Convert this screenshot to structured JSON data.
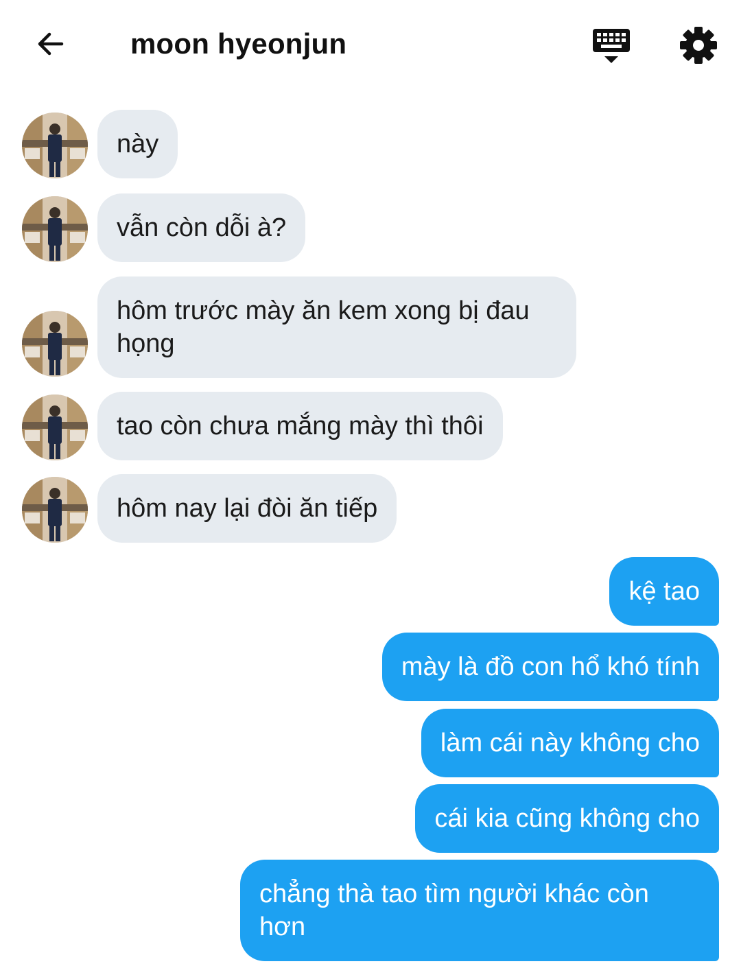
{
  "header": {
    "title": "moon hyeonjun",
    "back_icon": "arrow-left-icon",
    "keyboard_icon": "keyboard-icon",
    "settings_icon": "gear-icon"
  },
  "colors": {
    "incoming_bubble": "#e6ebf0",
    "outgoing_bubble": "#1da1f2",
    "outgoing_text": "#ffffff",
    "incoming_text": "#1a1a1a"
  },
  "messages": {
    "incoming": [
      {
        "text": "này"
      },
      {
        "text": "vẫn còn dỗi à?"
      },
      {
        "text": "hôm trước mày ăn kem xong bị đau họng"
      },
      {
        "text": "tao còn chưa mắng mày thì thôi"
      },
      {
        "text": "hôm nay lại đòi ăn tiếp"
      }
    ],
    "outgoing": [
      {
        "text": "kệ tao"
      },
      {
        "text": "mày là đồ con hổ khó tính"
      },
      {
        "text": "làm cái này không cho"
      },
      {
        "text": "cái kia cũng không cho"
      },
      {
        "text": "chẳng thà tao tìm người khác còn hơn"
      }
    ]
  }
}
